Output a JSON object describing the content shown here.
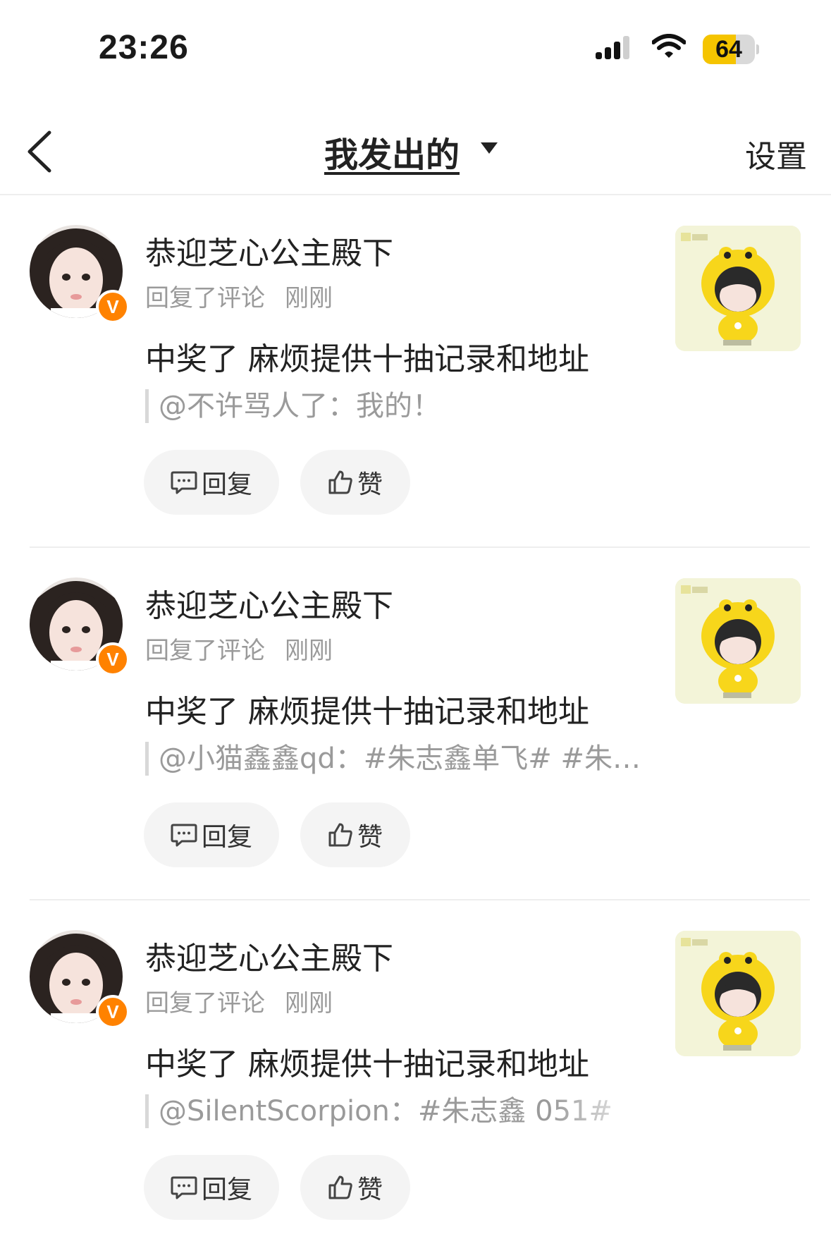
{
  "status_bar": {
    "time": "23:26",
    "battery": "64",
    "battery_level": 0.64
  },
  "nav": {
    "title": "我发出的",
    "settings": "设置"
  },
  "items": [
    {
      "username": "恭迎芝心公主殿下",
      "action": "回复了评论",
      "time": "刚刚",
      "content": "中奖了 麻烦提供十抽记录和地址",
      "quote": "@不许骂人了：我的！",
      "reply_label": "回复",
      "like_label": "赞",
      "badge": "V"
    },
    {
      "username": "恭迎芝心公主殿下",
      "action": "回复了评论",
      "time": "刚刚",
      "content": "中奖了 麻烦提供十抽记录和地址",
      "quote": "@小猫鑫鑫qd：#朱志鑫单飞# #朱…",
      "reply_label": "回复",
      "like_label": "赞",
      "badge": "V"
    },
    {
      "username": "恭迎芝心公主殿下",
      "action": "回复了评论",
      "time": "刚刚",
      "content": "中奖了 麻烦提供十抽记录和地址",
      "quote": "@SilentScorpion：#朱志鑫 051#",
      "reply_label": "回复",
      "like_label": "赞",
      "badge": "V"
    }
  ],
  "colors": {
    "accent": "#ff8200",
    "battery": "#f5c400",
    "muted": "#9a9a9a",
    "button_bg": "#f4f4f4"
  }
}
